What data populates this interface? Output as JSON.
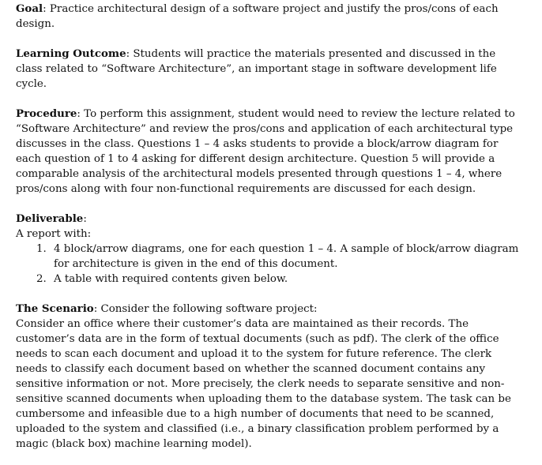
{
  "goal": {
    "label": "Goal",
    "text": ": Practice architectural design of a software project and justify the pros/cons of each design."
  },
  "learning_outcome": {
    "label": "Learning Outcome",
    "text": ": Students will practice the materials presented and discussed in the class related to “Software Architecture”, an important stage in software development life cycle."
  },
  "procedure": {
    "label": "Procedure",
    "text": ": To perform this assignment, student would need to review the lecture related to “Software Architecture” and review the pros/cons and application of each architectural type discusses in the class. Questions 1 – 4 asks students to provide a block/arrow diagram for each question of 1 to 4 asking for different design architecture. Question 5 will provide a comparable analysis of the architectural models presented through questions 1 – 4, where pros/cons along with four non-functional requirements are discussed for each design."
  },
  "deliverable": {
    "label": "Deliverable",
    "suffix": ":",
    "intro": "A report with:",
    "items": [
      {
        "num": "1.",
        "text": "4 block/arrow diagrams, one for each question 1 – 4. A sample of block/arrow diagram for architecture is given in the end of this document."
      },
      {
        "num": "2.",
        "text": "A table with required contents given below."
      }
    ]
  },
  "scenario": {
    "label": "The Scenario",
    "text": ": Consider the following software project:",
    "body": "Consider an office where their customer’s data are maintained as their records. The customer’s data are in the form of textual documents (such as pdf).  The clerk of the office needs to scan each document and upload it to the system for future reference. The clerk needs to classify each document based on whether the scanned document contains any sensitive information or not. More precisely, the clerk needs to separate sensitive and non-sensitive scanned documents when uploading them to the database system. The task can be cumbersome and infeasible due to a high number of documents that need to be scanned, uploaded to the system and classified (i.e., a binary classification problem performed by a magic (black box) machine learning model)."
  }
}
